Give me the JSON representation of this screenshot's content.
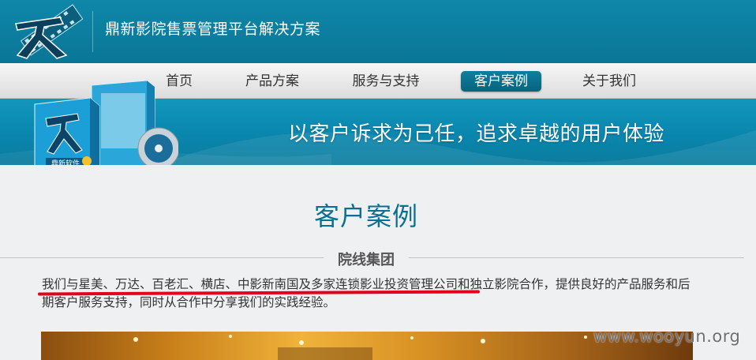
{
  "header": {
    "site_title": "鼎新影院售票管理平台解决方案"
  },
  "nav": {
    "items": [
      {
        "label": "首页"
      },
      {
        "label": "产品方案"
      },
      {
        "label": "服务与支持"
      },
      {
        "label": "客户案例",
        "active": true
      },
      {
        "label": "关于我们"
      }
    ]
  },
  "banner": {
    "slogan": "以客户诉求为己任，追求卓越的用户体验",
    "product_label": "鼎新软件"
  },
  "main": {
    "page_heading": "客户案例",
    "section_title": "院线集团",
    "description": "我们与星美、万达、百老汇、横店、中影新南国及多家连锁影业投资管理公司和独立影院合作，提供良好的产品服务和后期客户服务支持，同时从合作中分享我们的实践经验。"
  },
  "watermark": "www.wooyun.org",
  "colors": {
    "header_bg": "#0f87a9",
    "nav_active_bg": "#0e7f9e",
    "heading": "#0c6f8f",
    "highlight_underline": "#e3001b"
  }
}
